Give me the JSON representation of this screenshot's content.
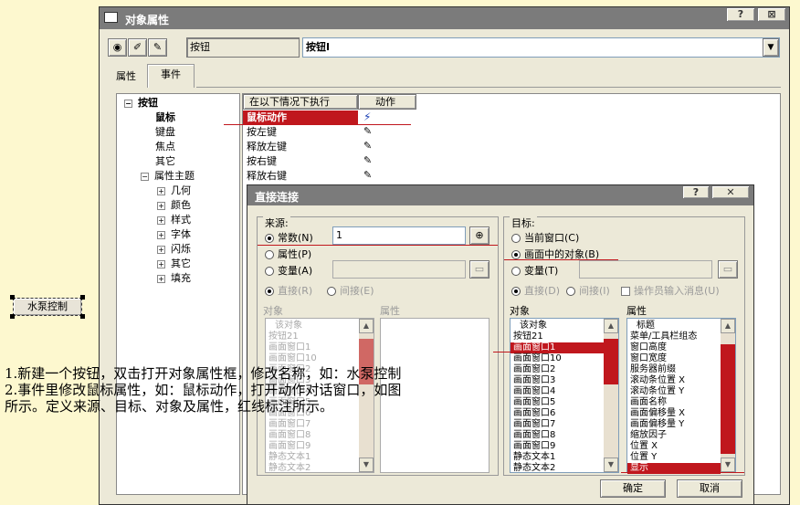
{
  "canvas_widget": {
    "label": "水泵控制"
  },
  "props_window": {
    "title": "对象属性",
    "help_btn": "?",
    "close_btn": "⊠",
    "object_type": "按钮",
    "object_name": "按钮I",
    "tabs": [
      "属性",
      "事件"
    ],
    "tree": {
      "root": "按钮",
      "children": [
        "鼠标",
        "键盘",
        "焦点",
        "其它"
      ],
      "theme": "属性主题",
      "theme_children": [
        "几何",
        "颜色",
        "样式",
        "字体",
        "闪烁",
        "其它",
        "填充"
      ]
    },
    "event_table": {
      "headers": [
        "在以下情况下执行",
        "动作"
      ],
      "rows": [
        "鼠标动作",
        "按左键",
        "释放左键",
        "按右键",
        "释放右键"
      ]
    }
  },
  "direct_dialog": {
    "title": "直接连接",
    "help_btn": "?",
    "close_btn": "✕",
    "source": {
      "group": "来源:",
      "const_label": "常数(N)",
      "const_value": "1",
      "prop_label": "属性(P)",
      "var_label": "变量(A)",
      "direct_label": "直接(R)",
      "indirect_label": "间接(E)",
      "obj_header": "对象",
      "prop_header": "属性",
      "objects": [
        "该对象",
        "按钮21",
        "画面窗口1",
        "画面窗口10",
        "画面窗口2",
        "画面窗口3",
        "画面窗口4",
        "画面窗口5",
        "画面窗口6",
        "画面窗口7",
        "画面窗口8",
        "画面窗口9",
        "静态文本1",
        "静态文本2"
      ]
    },
    "target": {
      "group": "目标:",
      "current_label": "当前窗口(C)",
      "object_label": "画面中的对象(B)",
      "var_label": "变量(T)",
      "direct_label": "直接(D)",
      "indirect_label": "间接(I)",
      "opmsg_label": "操作员输入消息(U)",
      "obj_header": "对象",
      "prop_header": "属性",
      "objects": [
        "该对象",
        "按钮21",
        "画面窗口1",
        "画面窗口10",
        "画面窗口2",
        "画面窗口3",
        "画面窗口4",
        "画面窗口5",
        "画面窗口6",
        "画面窗口7",
        "画面窗口8",
        "画面窗口9",
        "静态文本1",
        "静态文本2"
      ],
      "selected_object": "画面窗口1",
      "properties": [
        "标题",
        "菜单/工具栏组态",
        "窗口高度",
        "窗口宽度",
        "服务器前缀",
        "滚动条位置 X",
        "滚动条位置 Y",
        "画面名称",
        "画面偏移量 X",
        "画面偏移量 Y",
        "缩放因子",
        "位置 X",
        "位置 Y",
        "显示"
      ],
      "selected_property": "显示"
    },
    "ok": "确定",
    "cancel": "取消"
  },
  "annotation": [
    "1.新建一个按钮，双击打开对象属性框，修改名称，如：水泵控制",
    "2.事件里修改鼠标属性，如：鼠标动作，打开动作对话窗口，如图",
    "所示。定义来源、目标、对象及属性，红线标注所示。"
  ],
  "colors": {
    "highlight": "#c0171d",
    "dialog_title": "#7b7b7b",
    "annotation_line": "#c0171d"
  }
}
